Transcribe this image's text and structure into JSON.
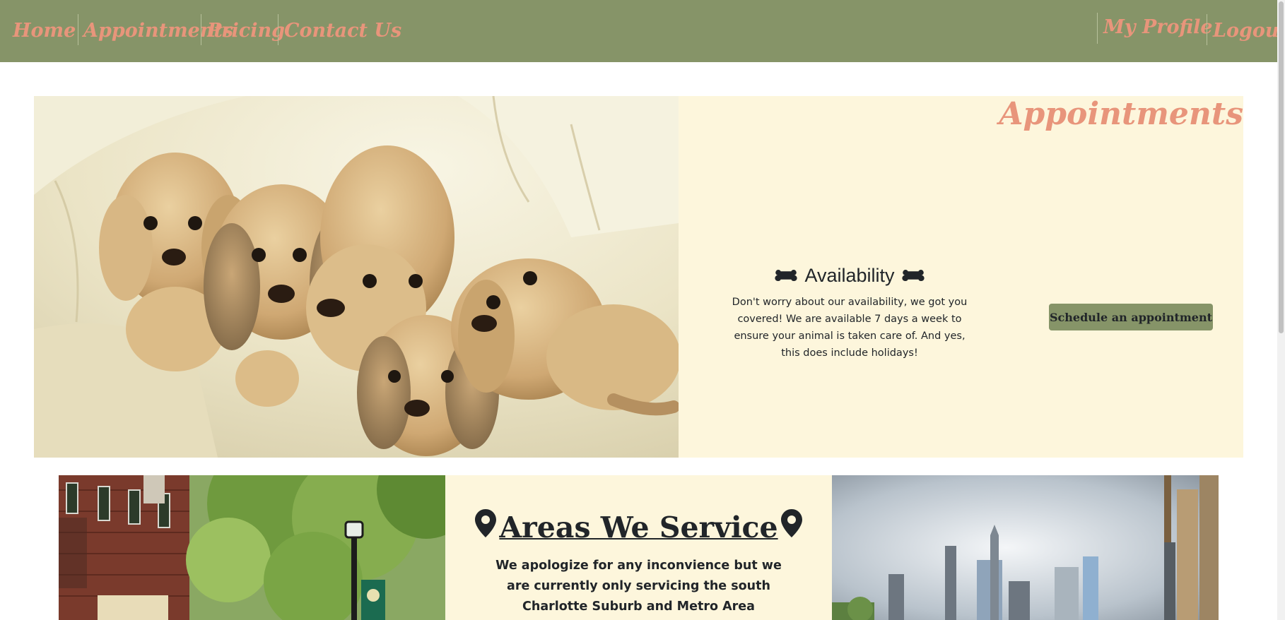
{
  "nav": {
    "items": [
      {
        "label": "Home"
      },
      {
        "label": "Appointments"
      },
      {
        "label": "Pricing"
      },
      {
        "label": "Contact Us"
      }
    ],
    "right": [
      {
        "label": "My Profile"
      },
      {
        "label": "Logout"
      }
    ]
  },
  "hero": {
    "title": "Appointments",
    "availability_heading": "Availability",
    "availability_text": "Don't worry about our availability, we got you covered! We are available 7 days a week to ensure your animal is taken care of. And yes, this does include holidays!",
    "schedule_button": "Schedule an appointment",
    "photo_subject": "puppies-on-couch"
  },
  "areas": {
    "heading": "Areas We Service",
    "text": "We apologize for any inconvience but we are currently only servicing the south Charlotte Suburb and Metro Area"
  },
  "colors": {
    "nav_bg": "#869468",
    "accent": "#e8957b",
    "panel_bg": "#fdf6dc",
    "text": "#212529"
  }
}
